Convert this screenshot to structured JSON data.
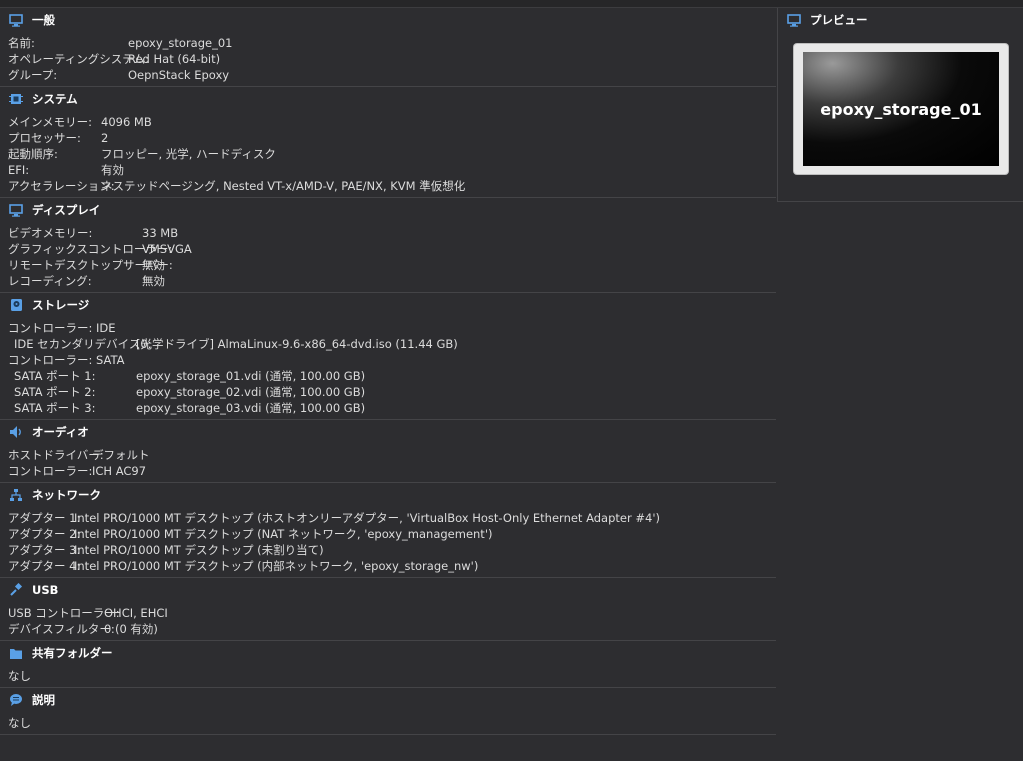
{
  "sections": {
    "general": {
      "title": "一般",
      "icon": "monitor-icon",
      "rows": [
        {
          "label": "名前:",
          "value": "epoxy_storage_01"
        },
        {
          "label": "オペレーティングシステム:",
          "value": "Red Hat (64-bit)"
        },
        {
          "label": "グループ:",
          "value": "OepnStack Epoxy"
        }
      ]
    },
    "system": {
      "title": "システム",
      "icon": "chip-icon",
      "rows": [
        {
          "label": "メインメモリー:",
          "value": "4096 MB"
        },
        {
          "label": "プロセッサー:",
          "value": "2"
        },
        {
          "label": "起動順序:",
          "value": "フロッピー, 光学, ハードディスク"
        },
        {
          "label": "EFI:",
          "value": "有効"
        },
        {
          "label": "アクセラレーション:",
          "value": "ネステッドページング, Nested VT-x/AMD-V, PAE/NX, KVM 準仮想化"
        }
      ]
    },
    "display": {
      "title": "ディスプレイ",
      "icon": "display-icon",
      "rows": [
        {
          "label": "ビデオメモリー:",
          "value": "33 MB"
        },
        {
          "label": "グラフィックスコントローラー:",
          "value": "VMSVGA"
        },
        {
          "label": "リモートデスクトップサーバー:",
          "value": "無効"
        },
        {
          "label": "レコーディング:",
          "value": "無効"
        }
      ]
    },
    "storage": {
      "title": "ストレージ",
      "icon": "storage-icon",
      "rows": [
        {
          "label": "コントローラー: IDE",
          "value": ""
        },
        {
          "label": "IDE セカンダリデバイス0:",
          "value": "[光学ドライブ] AlmaLinux-9.6-x86_64-dvd.iso (11.44 GB)"
        },
        {
          "label": "コントローラー: SATA",
          "value": ""
        },
        {
          "label": "SATA ポート 1:",
          "value": "epoxy_storage_01.vdi (通常, 100.00 GB)"
        },
        {
          "label": "SATA ポート 2:",
          "value": "epoxy_storage_02.vdi (通常, 100.00 GB)"
        },
        {
          "label": "SATA ポート 3:",
          "value": "epoxy_storage_03.vdi (通常, 100.00 GB)"
        }
      ]
    },
    "audio": {
      "title": "オーディオ",
      "icon": "speaker-icon",
      "rows": [
        {
          "label": "ホストドライバー:",
          "value": "デフォルト"
        },
        {
          "label": "コントローラー:",
          "value": "ICH AC97"
        }
      ]
    },
    "network": {
      "title": "ネットワーク",
      "icon": "network-icon",
      "rows": [
        {
          "label": "アダプター 1:",
          "value": "Intel PRO/1000 MT デスクトップ (ホストオンリーアダプター, 'VirtualBox Host-Only Ethernet Adapter #4')"
        },
        {
          "label": "アダプター 2:",
          "value": "Intel PRO/1000 MT デスクトップ (NAT ネットワーク, 'epoxy_management')"
        },
        {
          "label": "アダプター 3:",
          "value": "Intel PRO/1000 MT デスクトップ (未割り当て)"
        },
        {
          "label": "アダプター 4:",
          "value": "Intel PRO/1000 MT デスクトップ (内部ネットワーク, 'epoxy_storage_nw')"
        }
      ]
    },
    "usb": {
      "title": "USB",
      "icon": "usb-icon",
      "rows": [
        {
          "label": "USB コントローラー:",
          "value": "OHCI, EHCI"
        },
        {
          "label": "デバイスフィルター:",
          "value": "0 (0 有効)"
        }
      ]
    },
    "shared": {
      "title": "共有フォルダー",
      "icon": "folder-icon",
      "rows": [
        {
          "label": "なし",
          "value": ""
        }
      ]
    },
    "description": {
      "title": "説明",
      "icon": "speech-bubble-icon",
      "rows": [
        {
          "label": "なし",
          "value": ""
        }
      ]
    }
  },
  "preview": {
    "title": "プレビュー",
    "vm_name": "epoxy_storage_01"
  },
  "colors": {
    "background": "#2d2d30",
    "accent": "#5aa0e6",
    "text": "#dcdcdc"
  }
}
